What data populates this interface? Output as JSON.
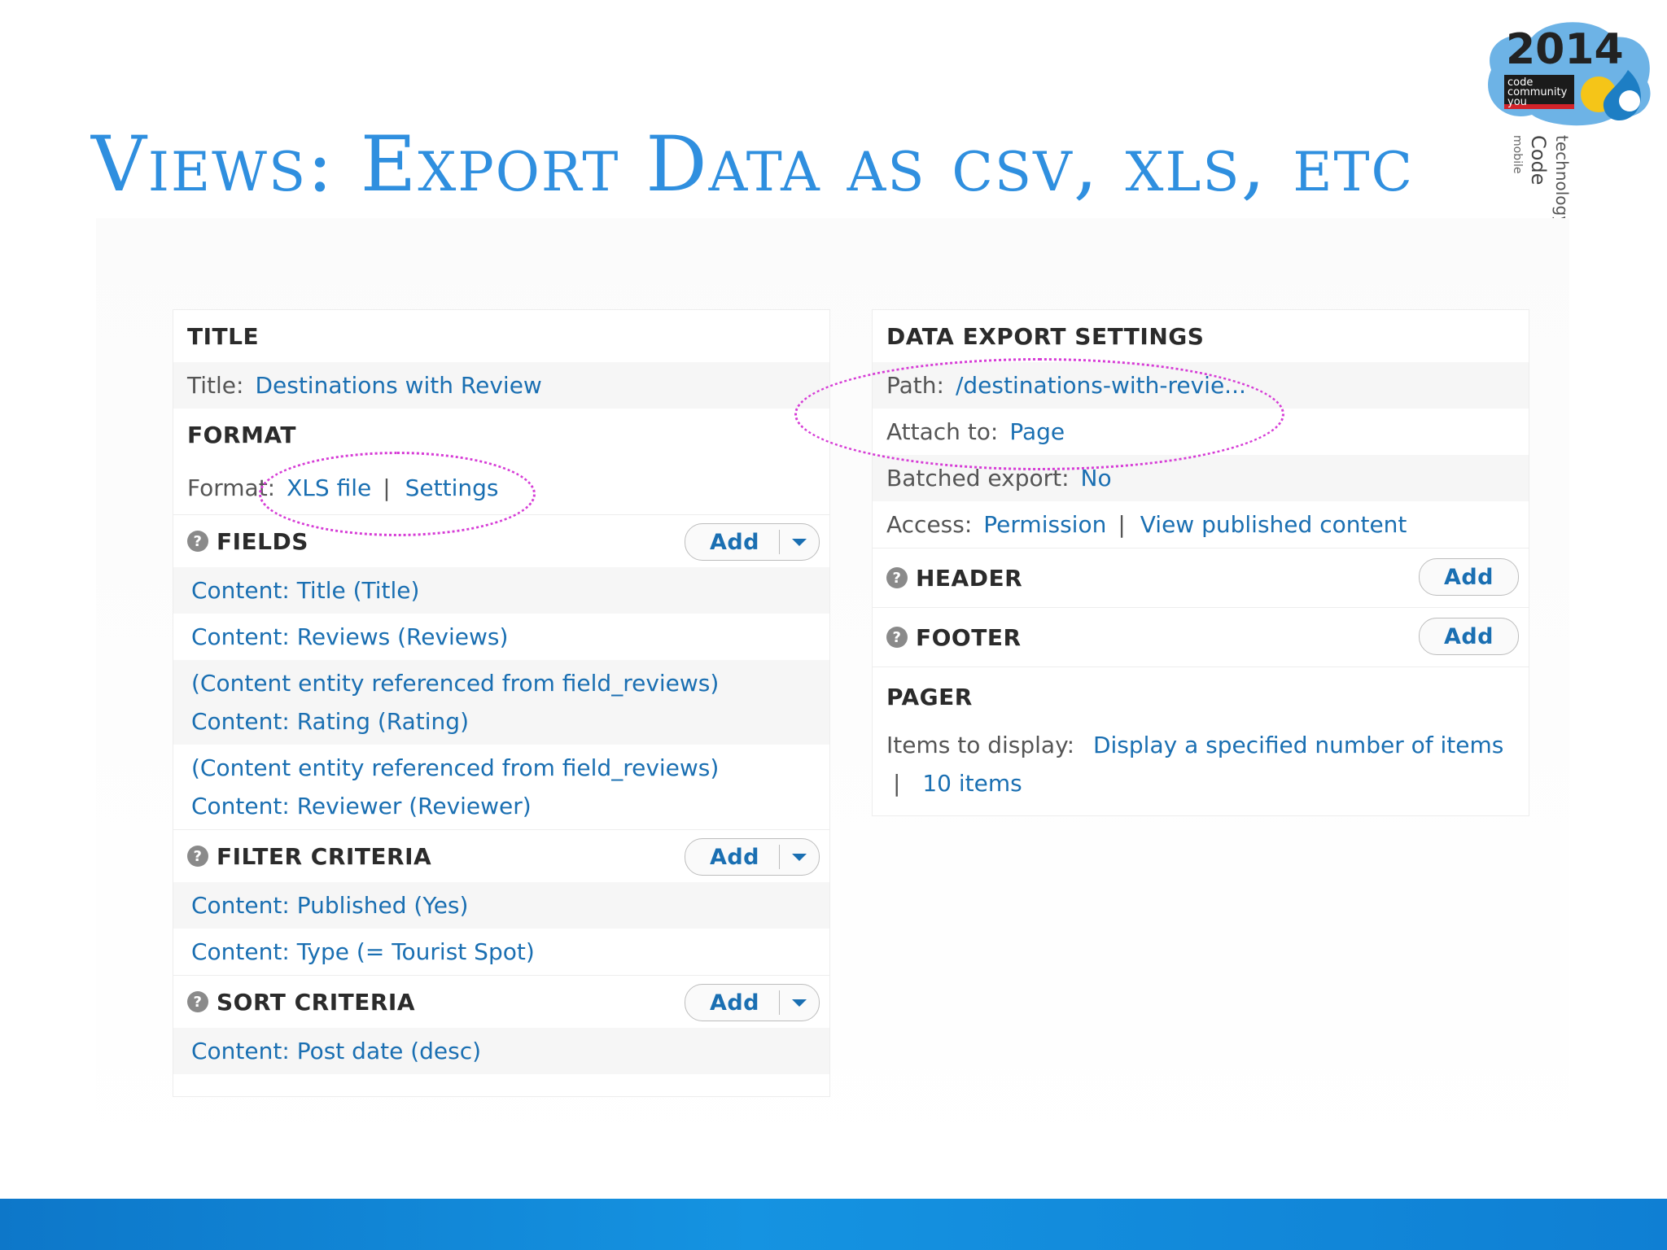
{
  "slide": {
    "title": "Views: Export Data as csv, xls, etc"
  },
  "logo": {
    "year": "2014",
    "tagline": "code community you"
  },
  "left_panel": {
    "title_section": {
      "heading": "TITLE",
      "label": "Title:",
      "value": "Destinations with Review"
    },
    "format_section": {
      "heading": "FORMAT",
      "label": "Format:",
      "value": "XLS file",
      "separator": "|",
      "settings": "Settings"
    },
    "fields": {
      "heading": "FIELDS",
      "add": "Add",
      "items": [
        "Content: Title (Title)",
        "Content: Reviews (Reviews)",
        "(Content entity referenced from field_reviews)",
        "Content: Rating (Rating)",
        "(Content entity referenced from field_reviews)",
        "Content: Reviewer (Reviewer)"
      ]
    },
    "filter_criteria": {
      "heading": "FILTER CRITERIA",
      "add": "Add",
      "items": [
        "Content: Published (Yes)",
        "Content: Type (= Tourist Spot)"
      ]
    },
    "sort_criteria": {
      "heading": "SORT CRITERIA",
      "add": "Add",
      "items": [
        "Content: Post date (desc)"
      ]
    }
  },
  "right_panel": {
    "data_export": {
      "heading": "DATA EXPORT SETTINGS",
      "path_label": "Path:",
      "path_value": "/destinations-with-revie...",
      "attach_label": "Attach to:",
      "attach_value": "Page",
      "batched_label": "Batched export:",
      "batched_value": "No",
      "access_label": "Access:",
      "access_value": "Permission",
      "access_separator": "|",
      "access_value2": "View published content"
    },
    "header": {
      "heading": "HEADER",
      "add": "Add"
    },
    "footer": {
      "heading": "FOOTER",
      "add": "Add"
    },
    "pager": {
      "heading": "PAGER",
      "items_label": "Items to display:",
      "items_value": "Display a specified number of items",
      "separator": "|",
      "count_value": "10 items"
    }
  },
  "colors": {
    "title_blue": "#2f8fdf",
    "link_blue": "#1a6fb2",
    "annotation_magenta": "#d63cd6",
    "bar_blue": "#1593e1"
  },
  "icons": {
    "help": "question-mark-icon",
    "dropdown": "caret-down-icon"
  }
}
